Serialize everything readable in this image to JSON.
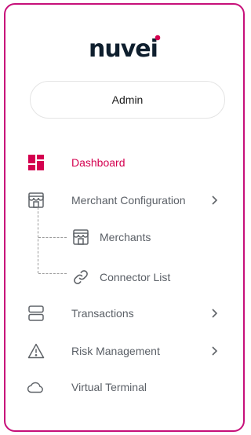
{
  "brand": {
    "name": "nuvei",
    "logo_color": "#0f1f2e",
    "accent_dot": "#d4004f"
  },
  "user_button": {
    "label": "Admin"
  },
  "colors": {
    "accent": "#d4004f",
    "border": "#c7107a",
    "text_muted": "#5a5f66",
    "icon": "#5f6368"
  },
  "nav": {
    "dashboard": {
      "label": "Dashboard",
      "icon": "dashboard-icon",
      "active": true
    },
    "merchant_configuration": {
      "label": "Merchant Configuration",
      "icon": "store-icon",
      "expanded": true,
      "children": [
        {
          "label": "Merchants",
          "icon": "store-icon"
        },
        {
          "label": "Connector List",
          "icon": "link-icon"
        }
      ]
    },
    "transactions": {
      "label": "Transactions",
      "icon": "transactions-icon"
    },
    "risk_management": {
      "label": "Risk Management",
      "icon": "warning-icon"
    },
    "virtual_terminal": {
      "label": "Virtual Terminal",
      "icon": "cloud-icon"
    }
  }
}
